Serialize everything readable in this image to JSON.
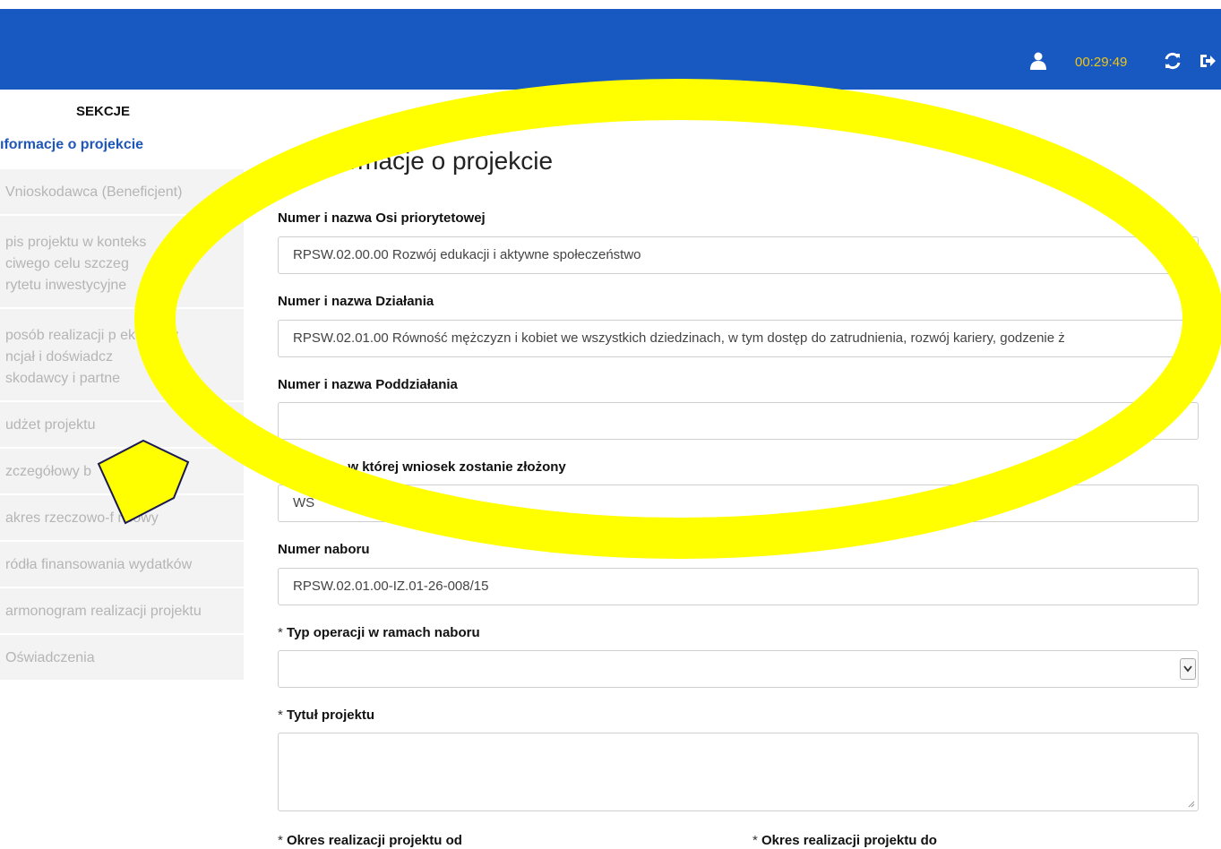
{
  "header": {
    "timer": "00:29:49",
    "icons": {
      "user": "user-icon",
      "refresh": "refresh-icon",
      "logout": "logout-icon"
    },
    "colors": {
      "bar": "#1759c0",
      "timer": "#f0c419"
    }
  },
  "sidebar": {
    "title": "SEKCJE",
    "active_item": "ıformacje o projekcie",
    "items": [
      {
        "lines": [
          "Vnioskodawca (Beneficjent)"
        ]
      },
      {
        "lines": [
          "pis projektu w konteks",
          "ciwego celu szczeg ",
          "rytetu inwestycyjne "
        ]
      },
      {
        "lines": [
          "posób realizacji p ektu oraz",
          "ncjał i doświadcz ",
          "skodawcy i partne "
        ]
      },
      {
        "lines": [
          "udżet projektu"
        ]
      },
      {
        "lines": [
          "zczegółowy b  "
        ]
      },
      {
        "lines": [
          "akres rzeczowo-f  nsowy"
        ]
      },
      {
        "lines": [
          "ródła finansowania wydatków"
        ]
      },
      {
        "lines": [
          "armonogram realizacji projektu"
        ]
      },
      {
        "lines": [
          "Oświadczenia"
        ]
      }
    ]
  },
  "main": {
    "title": "1. Informacje o projekcie",
    "fields": {
      "os_label": "Numer i nazwa Osi priorytetowej",
      "os_value": "RPSW.02.00.00 Rozwój edukacji i aktywne społeczeństwo",
      "dzialanie_label": "Numer i nazwa Działania",
      "dzialanie_value": "RPSW.02.01.00 Równość mężczyzn i kobiet we wszystkich dziedzinach, w tym dostęp do zatrudnienia, rozwój kariery, godzenie ż",
      "poddzialanie_label": "Numer i nazwa Poddziałania",
      "poddzialanie_value": "",
      "instytucja_label": "Instytucja, w której wniosek zostanie złożony",
      "instytucja_value": "  WŚ",
      "nabor_label": "Numer naboru",
      "nabor_value": "RPSW.02.01.00-IZ.01-26-008/15",
      "typ_label": "Typ operacji w ramach naboru",
      "typ_value": "",
      "tytul_label": "Tytuł projektu",
      "tytul_value": "",
      "od_label": "Okres realizacji projektu od",
      "do_label": "Okres realizacji projektu do",
      "required_mark": "*"
    }
  },
  "annotation": {
    "color": "#ffff00"
  }
}
